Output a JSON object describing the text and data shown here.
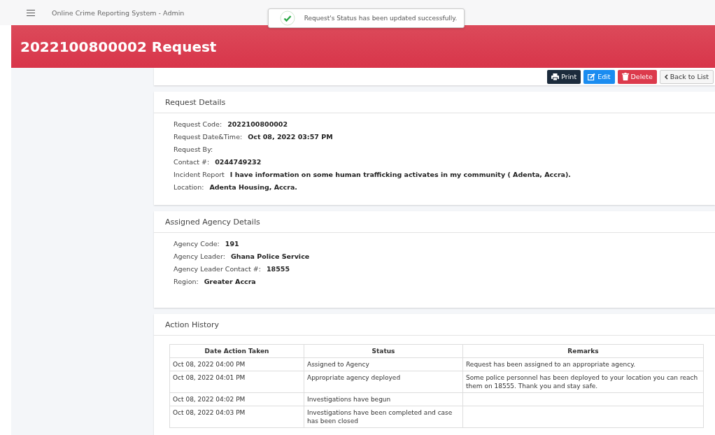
{
  "topbar": {
    "title": "Online Crime Reporting System - Admin"
  },
  "toast": {
    "message": "Request's Status has been updated successfully."
  },
  "header": {
    "title": "2022100800002 Request"
  },
  "actions": [
    {
      "kind": "print",
      "label": "Print"
    },
    {
      "kind": "edit",
      "label": "Edit"
    },
    {
      "kind": "delete",
      "label": "Delete"
    },
    {
      "kind": "back",
      "label": "Back to List"
    }
  ],
  "request_details": {
    "title": "Request Details",
    "fields": [
      {
        "label": "Request Code:",
        "value": "2022100800002"
      },
      {
        "label": "Request Date&Time:",
        "value": "Oct 08, 2022 03:57 PM"
      },
      {
        "label": "Request By:"
      },
      {
        "label": "Contact #:",
        "value": "0244749232"
      },
      {
        "label": "Incident Report",
        "value": "I have information on some human trafficking activates in my community ( Adenta, Accra)."
      },
      {
        "label": "Location:",
        "value": "Adenta Housing, Accra."
      }
    ]
  },
  "agency_details": {
    "title": "Assigned Agency Details",
    "fields": [
      {
        "label": "Agency Code:",
        "value": "191"
      },
      {
        "label": "Agency Leader:",
        "value": "Ghana Police Service"
      },
      {
        "label": "Agency Leader Contact #:",
        "value": "18555"
      },
      {
        "label": "Region:",
        "value": "Greater Accra"
      }
    ]
  },
  "action_history": {
    "title": "Action History",
    "columns": [
      "Date Action Taken",
      "Status",
      "Remarks"
    ],
    "rows": [
      [
        "Oct 08, 2022 04:00 PM",
        "Assigned to Agency",
        "Request has been assigned to an appropriate agency."
      ],
      [
        "Oct 08, 2022 04:01 PM",
        "Appropriate agency deployed",
        "Some police personnel has been deployed to your location you can reach them on 18555. Thank you and stay safe."
      ],
      [
        "Oct 08, 2022 04:02 PM",
        "Investigations have begun",
        ""
      ],
      [
        "Oct 08, 2022 04:03 PM",
        "Investigations have been completed and case has been closed",
        ""
      ]
    ]
  }
}
